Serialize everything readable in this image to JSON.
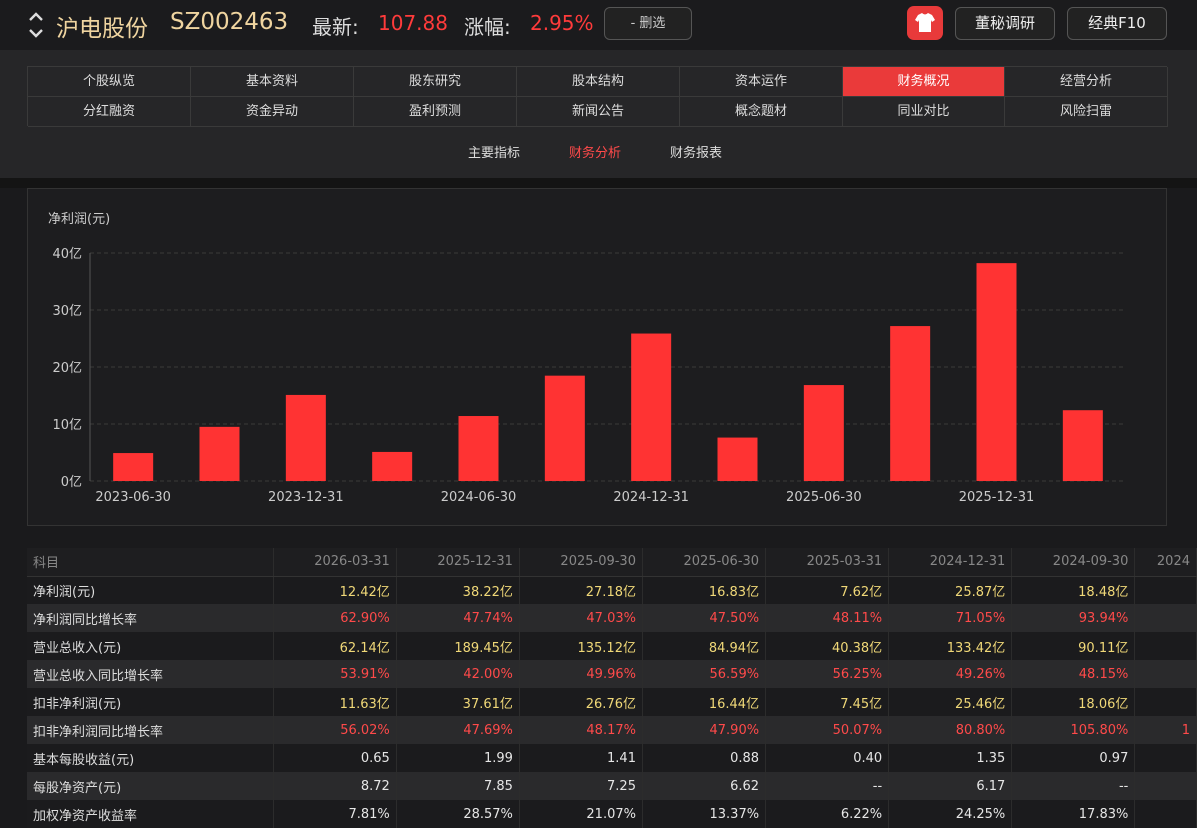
{
  "header": {
    "stock_name": "沪电股份",
    "stock_code": "SZ002463",
    "latest_label": "最新:",
    "latest_value": "107.88",
    "change_label": "涨幅:",
    "change_value": "2.95%",
    "delete_label": "- 删选",
    "dongmi_label": "董秘调研",
    "f10_label": "经典F10"
  },
  "nav": {
    "row1": [
      "个股纵览",
      "基本资料",
      "股东研究",
      "股本结构",
      "资本运作",
      "财务概况",
      "经营分析"
    ],
    "row2": [
      "分红融资",
      "资金异动",
      "盈利预测",
      "新闻公告",
      "概念题材",
      "同业对比",
      "风险扫雷"
    ],
    "active": "财务概况",
    "subtabs": [
      "主要指标",
      "财务分析",
      "财务报表"
    ],
    "active_sub": "财务分析"
  },
  "colors": {
    "accent": "#ea3a3a",
    "up": "#ff4a4a",
    "value": "#f0d878"
  },
  "chart_data": {
    "type": "bar",
    "title": "净利润(元)",
    "x": [
      "2023-06-30",
      "2023-09-30",
      "2023-12-31",
      "2024-03-31",
      "2024-06-30",
      "2024-09-30",
      "2024-12-31",
      "2025-03-31",
      "2025-06-30",
      "2025-09-30",
      "2025-12-31",
      "2026-03-31"
    ],
    "values": [
      4.9,
      9.5,
      15.1,
      5.1,
      11.4,
      18.48,
      25.87,
      7.62,
      16.83,
      27.18,
      38.22,
      12.42
    ],
    "xticks_shown": [
      "2023-06-30",
      "2023-12-31",
      "2024-06-30",
      "2024-12-31",
      "2025-06-30",
      "2025-12-31"
    ],
    "yticks": [
      0,
      10,
      20,
      30,
      40
    ],
    "ytick_labels": [
      "0亿",
      "10亿",
      "20亿",
      "30亿",
      "40亿"
    ],
    "ylim": [
      0,
      40
    ],
    "unit": "亿",
    "grid": true,
    "color": "#ff3333"
  },
  "table": {
    "header_label": "科目",
    "columns": [
      "2026-03-31",
      "2025-12-31",
      "2025-09-30",
      "2025-06-30",
      "2025-03-31",
      "2024-12-31",
      "2024-09-30",
      "2024"
    ],
    "rows": [
      {
        "name": "净利润(元)",
        "cls": "y",
        "values": [
          "12.42亿",
          "38.22亿",
          "27.18亿",
          "16.83亿",
          "7.62亿",
          "25.87亿",
          "18.48亿",
          ""
        ]
      },
      {
        "name": "净利润同比增长率",
        "cls": "r",
        "values": [
          "62.90%",
          "47.74%",
          "47.03%",
          "47.50%",
          "48.11%",
          "71.05%",
          "93.94%",
          ""
        ]
      },
      {
        "name": "营业总收入(元)",
        "cls": "y",
        "values": [
          "62.14亿",
          "189.45亿",
          "135.12亿",
          "84.94亿",
          "40.38亿",
          "133.42亿",
          "90.11亿",
          ""
        ]
      },
      {
        "name": "营业总收入同比增长率",
        "cls": "r",
        "values": [
          "53.91%",
          "42.00%",
          "49.96%",
          "56.59%",
          "56.25%",
          "49.26%",
          "48.15%",
          ""
        ]
      },
      {
        "name": "扣非净利润(元)",
        "cls": "y",
        "values": [
          "11.63亿",
          "37.61亿",
          "26.76亿",
          "16.44亿",
          "7.45亿",
          "25.46亿",
          "18.06亿",
          ""
        ]
      },
      {
        "name": "扣非净利润同比增长率",
        "cls": "r",
        "values": [
          "56.02%",
          "47.69%",
          "48.17%",
          "47.90%",
          "50.07%",
          "80.80%",
          "105.80%",
          "1"
        ]
      },
      {
        "name": "基本每股收益(元)",
        "cls": "n",
        "values": [
          "0.65",
          "1.99",
          "1.41",
          "0.88",
          "0.40",
          "1.35",
          "0.97",
          ""
        ]
      },
      {
        "name": "每股净资产(元)",
        "cls": "n",
        "values": [
          "8.72",
          "7.85",
          "7.25",
          "6.62",
          "--",
          "6.17",
          "--",
          ""
        ]
      },
      {
        "name": "加权净资产收益率",
        "cls": "n",
        "values": [
          "7.81%",
          "28.57%",
          "21.07%",
          "13.37%",
          "6.22%",
          "24.25%",
          "17.83%",
          ""
        ]
      }
    ]
  }
}
